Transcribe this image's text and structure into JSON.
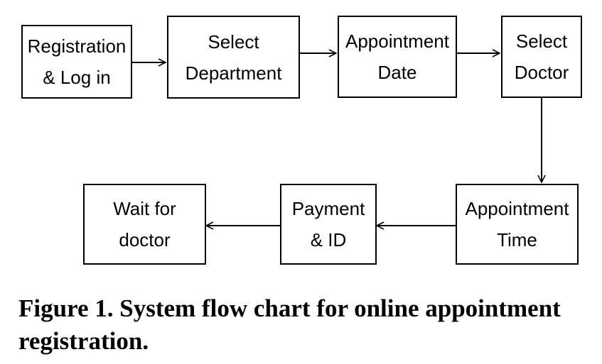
{
  "flowchart": {
    "steps": [
      {
        "id": "registration",
        "label": "Registration\n& Log in"
      },
      {
        "id": "select-department",
        "label": "Select\nDepartment"
      },
      {
        "id": "appointment-date",
        "label": "Appointment\nDate"
      },
      {
        "id": "select-doctor",
        "label": "Select\nDoctor"
      },
      {
        "id": "appointment-time",
        "label": "Appointment\nTime"
      },
      {
        "id": "payment-id",
        "label": "Payment\n& ID"
      },
      {
        "id": "wait-for-doctor",
        "label": "Wait for\ndoctor"
      }
    ],
    "connections": [
      {
        "from": "registration",
        "to": "select-department"
      },
      {
        "from": "select-department",
        "to": "appointment-date"
      },
      {
        "from": "appointment-date",
        "to": "select-doctor"
      },
      {
        "from": "select-doctor",
        "to": "appointment-time"
      },
      {
        "from": "appointment-time",
        "to": "payment-id"
      },
      {
        "from": "payment-id",
        "to": "wait-for-doctor"
      }
    ]
  },
  "caption": "Figure 1. System flow chart for online appointment registration."
}
